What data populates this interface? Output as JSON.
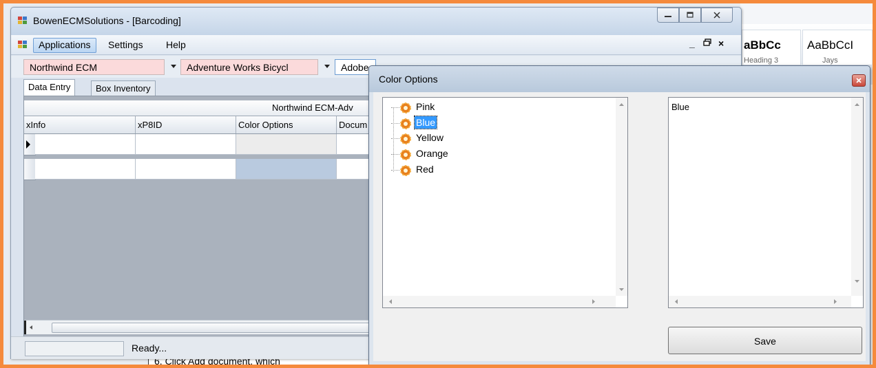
{
  "app": {
    "title": "BowenECMSolutions - [Barcoding]",
    "menu": [
      "Applications",
      "Settings",
      "Help"
    ],
    "mdi_controls": [
      "_",
      "×"
    ],
    "combos": [
      "Northwind ECM",
      "Adventure Works Bicycl",
      "Adobe"
    ],
    "tabs": [
      "Data Entry",
      "Box Inventory"
    ],
    "grid_caption": "Northwind ECM-Adv",
    "columns": [
      "xInfo",
      "xP8ID",
      "Color Options",
      "Docum"
    ],
    "status": "Ready..."
  },
  "dialog": {
    "title": "Color Options",
    "tree_items": [
      "Pink",
      "Blue",
      "Yellow",
      "Orange",
      "Red"
    ],
    "selected_item": "Blue",
    "selected_value": "Blue",
    "save_label": "Save"
  },
  "background_doc": {
    "styles": [
      {
        "sample": "aBbCc",
        "name": "Heading 3"
      },
      {
        "sample": "AaBbCcI",
        "name": "Jays"
      }
    ],
    "body_text": "6.   Click Add document, which"
  },
  "colors": {
    "frame": "#f58a3c",
    "combo_fill": "#fbdadb",
    "tree_selection": "#3399ff",
    "grid_selected_cell": "#b9cadf"
  }
}
